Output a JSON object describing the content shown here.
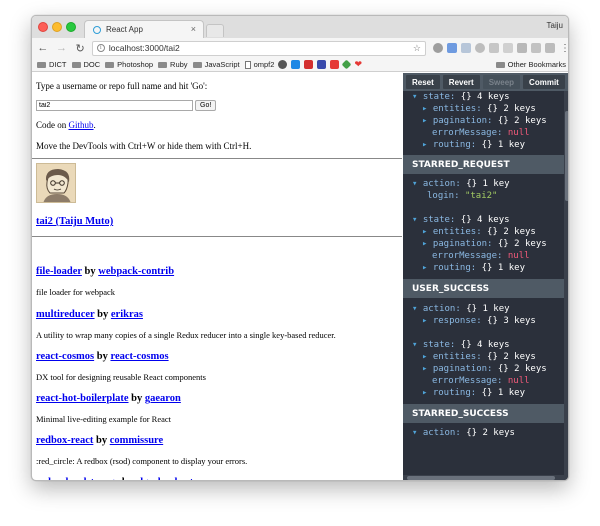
{
  "browser": {
    "tab_title": "React App",
    "tab_close": "×",
    "profile_name": "Taiju",
    "url": "localhost:3000/tai2",
    "bookmarks": [
      {
        "label": "DICT",
        "type": "folder"
      },
      {
        "label": "DOC",
        "type": "folder"
      },
      {
        "label": "Photoshop",
        "type": "folder"
      },
      {
        "label": "Ruby",
        "type": "folder"
      },
      {
        "label": "JavaScript",
        "type": "folder"
      },
      {
        "label": "ompf2",
        "type": "file"
      }
    ],
    "other_bookmarks": "Other Bookmarks",
    "colors": {
      "accent_link": "#0000ee",
      "devtools_bg": "#2b303b",
      "devtools_header": "#4f5a65"
    }
  },
  "page": {
    "prompt": "Type a username or repo full name and hit 'Go':",
    "input_value": "tai2",
    "go_label": "Go!",
    "code_on": "Code on ",
    "github_link": "Github",
    "code_suffix": ".",
    "devtools_hint": "Move the DevTools with Ctrl+W or hide them with Ctrl+H.",
    "user_link": "tai2 (Taiju Muto)",
    "by": " by ",
    "repos": [
      {
        "name": "file-loader",
        "owner": "webpack-contrib",
        "desc": "file loader for webpack"
      },
      {
        "name": "multireducer",
        "owner": "erikras",
        "desc": "A utility to wrap many copies of a single Redux reducer into a single key-based reducer."
      },
      {
        "name": "react-cosmos",
        "owner": "react-cosmos",
        "desc": "DX tool for designing reusable React components"
      },
      {
        "name": "react-hot-boilerplate",
        "owner": "gaearon",
        "desc": "Minimal live-editing example for React"
      },
      {
        "name": "redbox-react",
        "owner": "commissure",
        "desc": ":red_circle: A redbox (rsod) component to display your errors."
      },
      {
        "name": "redux-localstorage",
        "owner": "elgerlambert",
        "desc": ""
      }
    ]
  },
  "devtools": {
    "buttons": {
      "reset": "Reset",
      "revert": "Revert",
      "sweep": "Sweep",
      "commit": "Commit"
    },
    "actions": {
      "starred_request": "STARRED_REQUEST",
      "user_success": "USER_SUCCESS",
      "starred_success": "STARRED_SUCCESS"
    },
    "lines": {
      "state": "state:",
      "action": "action:",
      "entities": "entities:",
      "pagination": "pagination:",
      "errorMessage": "errorMessage:",
      "routing": "routing:",
      "login": "login:",
      "response": "response:",
      "obj": "{}",
      "four_keys": "4 keys",
      "two_keys": "2 keys",
      "one_key": "1 key",
      "three_keys": "3 keys",
      "null": "null",
      "login_value": "\"tai2\""
    }
  }
}
